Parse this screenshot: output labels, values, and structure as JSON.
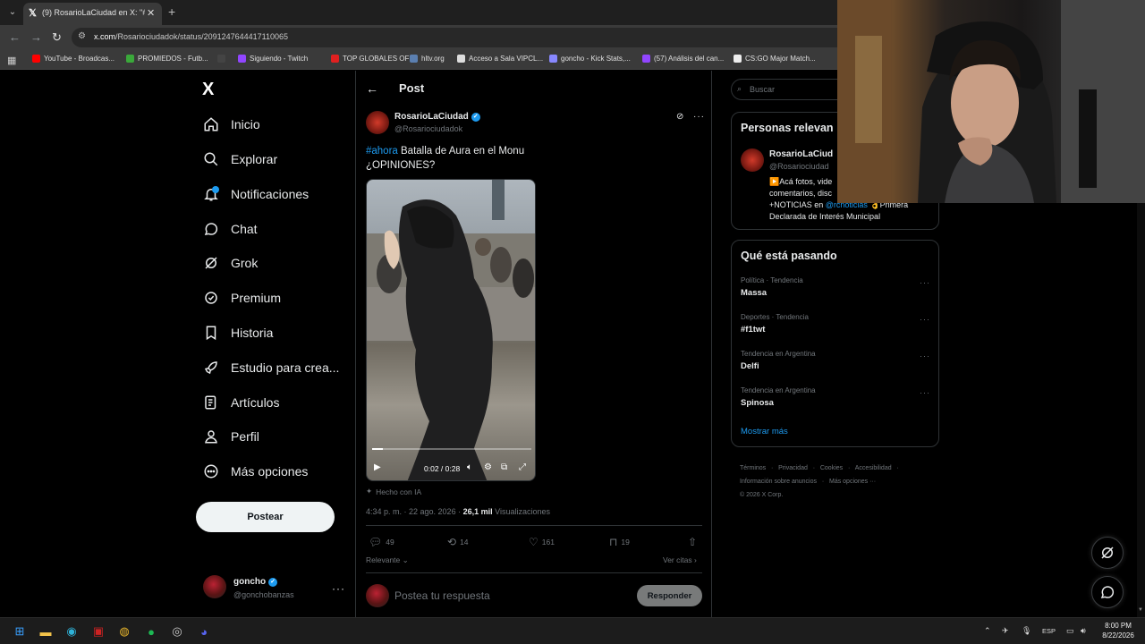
{
  "browser": {
    "tab_title": "(9) RosarioLaCiudad en X: \"#ah",
    "tab_close": "✕",
    "new_tab": "+",
    "url_host": "x.com",
    "url_path": "/Rosariociudadok/status/2091247644417110065",
    "bookmarks": [
      {
        "label": "YouTube - Broadcas...",
        "color": "#ff0000"
      },
      {
        "label": "PROMIEDOS - Futb...",
        "color": "#3aa83a"
      },
      {
        "label": "",
        "color": "#444444"
      },
      {
        "label": "Siguiendo - Twitch",
        "color": "#9146ff"
      },
      {
        "label": "TOP GLOBALES OFI...",
        "color": "#e02020"
      },
      {
        "label": "hltv.org",
        "color": "#5b7fb0"
      },
      {
        "label": "Acceso a Sala VIPCL...",
        "color": "#dddddd"
      },
      {
        "label": "goncho - Kick Stats,...",
        "color": "#8888ff"
      },
      {
        "label": "(57) Análisis del can...",
        "color": "#9146ff"
      },
      {
        "label": "CS:GO Major Match...",
        "color": "#eeeeee"
      }
    ]
  },
  "sidebar": {
    "logo": "X",
    "items": [
      {
        "label": "Inicio",
        "icon": "home-icon"
      },
      {
        "label": "Explorar",
        "icon": "search-icon"
      },
      {
        "label": "Notificaciones",
        "icon": "bell-icon"
      },
      {
        "label": "Chat",
        "icon": "chat-icon"
      },
      {
        "label": "Grok",
        "icon": "grok-icon"
      },
      {
        "label": "Premium",
        "icon": "premium-icon"
      },
      {
        "label": "Historia",
        "icon": "bookmark-icon"
      },
      {
        "label": "Estudio para crea...",
        "icon": "rocket-icon"
      },
      {
        "label": "Artículos",
        "icon": "article-icon"
      },
      {
        "label": "Perfil",
        "icon": "person-icon"
      },
      {
        "label": "Más opciones",
        "icon": "more-circle-icon"
      }
    ],
    "post_button": "Postear",
    "account": {
      "name": "goncho",
      "handle": "@gonchobanzas",
      "more": "···"
    }
  },
  "post": {
    "header_title": "Post",
    "author_name": "RosarioLaCiudad",
    "author_handle": "@Rosariociudadok",
    "more": "···",
    "hashtag": "#ahora",
    "text_rest": " Batalla de Aura en el Monu",
    "text_line2": "¿OPINIONES?",
    "video": {
      "current": "0:02",
      "separator": "/",
      "total": "0:28",
      "progress": 0.07
    },
    "ai_label": "Hecho con IA",
    "time": "4:34 p. m. · 22 ago. 2026 · ",
    "views_count": "26,1 mil",
    "views_label": " Visualizaciones",
    "actions": {
      "replies": "49",
      "reposts": "14",
      "likes": "161",
      "bookmarks": "19"
    },
    "sort_label": "Relevante",
    "quotes_label": "Ver citas",
    "reply_placeholder": "Postea tu respuesta",
    "reply_button": "Responder"
  },
  "right": {
    "search_placeholder": "Buscar",
    "relevant": {
      "title": "Personas relevan",
      "name": "RosarioLaCiud",
      "handle": "@Rosariociudad",
      "bio_line1": "▶️Acá fotos, vide",
      "bio_line2": "comentarios, disc",
      "bio_line3_prefix": "+NOTICIAS en ",
      "bio_link": "@rcnoticias",
      "bio_line3_suffix": " 👌Primera",
      "bio_line4": "Declarada de Interés Municipal"
    },
    "trends": {
      "title": "Qué está pasando",
      "items": [
        {
          "category": "Política · Tendencia",
          "name": "Massa"
        },
        {
          "category": "Deportes · Tendencia",
          "name": "#f1twt"
        },
        {
          "category": "Tendencia en Argentina",
          "name": "Delfi"
        },
        {
          "category": "Tendencia en Argentina",
          "name": "Spinosa"
        }
      ],
      "show_more": "Mostrar más"
    },
    "footer": {
      "line1": "Términos   ·   Privacidad   ·   Cookies   ·   Accesibilidad   ·",
      "line2": "Información sobre anuncios   ·   Más opciones ···",
      "line3": "© 2026 X Corp."
    }
  },
  "taskbar": {
    "lang": "ESP",
    "time": "8:00 PM",
    "date": "8/22/2026"
  }
}
